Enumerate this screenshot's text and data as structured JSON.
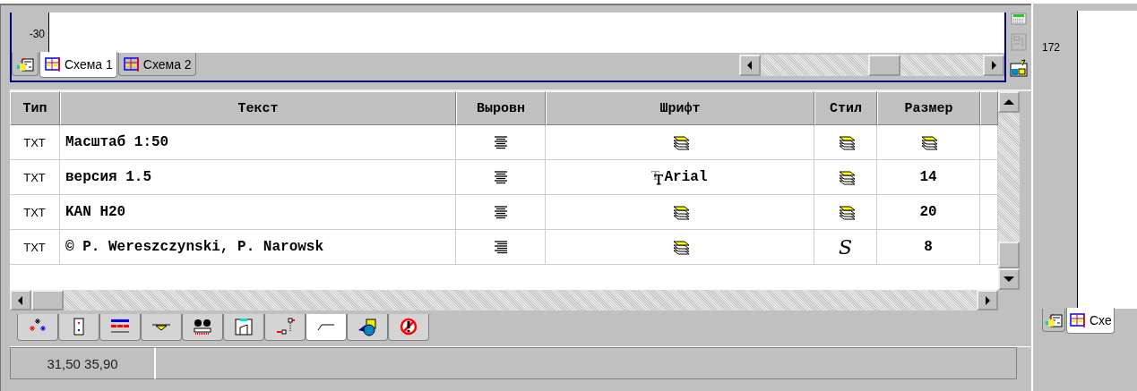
{
  "drawing_panel": {
    "ruler_label": "-30",
    "tabs": [
      {
        "kind": "icon",
        "selected": false
      },
      {
        "kind": "sheet",
        "label": "Схема 1",
        "selected": true
      },
      {
        "kind": "sheet",
        "label": "Схема 2",
        "selected": false
      }
    ]
  },
  "table": {
    "columns": [
      "Тип",
      "Текст",
      "Выровн",
      "Шрифт",
      "Стил",
      "Размер"
    ],
    "rows": [
      {
        "type": "TXT",
        "text": "Масштаб 1:50",
        "right_aligned": false,
        "font": {
          "kind": "inherit"
        },
        "style": {
          "kind": "inherit"
        },
        "size": {
          "kind": "inherit"
        }
      },
      {
        "type": "TXT",
        "text": "версия 1.5",
        "right_aligned": false,
        "font": {
          "kind": "font",
          "value": "Arial"
        },
        "style": {
          "kind": "inherit"
        },
        "size": {
          "kind": "value",
          "value": "14"
        }
      },
      {
        "type": "TXT",
        "text": "KAN H20",
        "right_aligned": false,
        "font": {
          "kind": "inherit"
        },
        "style": {
          "kind": "inherit"
        },
        "size": {
          "kind": "value",
          "value": "20"
        }
      },
      {
        "type": "TXT",
        "text": "© P. Wereszczynski, P. Narowsk",
        "right_aligned": true,
        "font": {
          "kind": "inherit"
        },
        "style": {
          "kind": "italic",
          "value": "S"
        },
        "size": {
          "kind": "value",
          "value": "8"
        }
      }
    ]
  },
  "tool_tabs": [
    {
      "selected": false
    },
    {
      "selected": false
    },
    {
      "selected": false
    },
    {
      "selected": false
    },
    {
      "selected": false
    },
    {
      "selected": false
    },
    {
      "selected": false
    },
    {
      "selected": true
    },
    {
      "selected": false
    },
    {
      "selected": false
    }
  ],
  "status_bar": {
    "coordinates": "31,50  35,90"
  },
  "side_panel": {
    "ruler_label": "172",
    "tabs": [
      {
        "kind": "icon",
        "selected": false
      },
      {
        "kind": "sheet",
        "label": "Схе",
        "selected": true
      }
    ]
  }
}
